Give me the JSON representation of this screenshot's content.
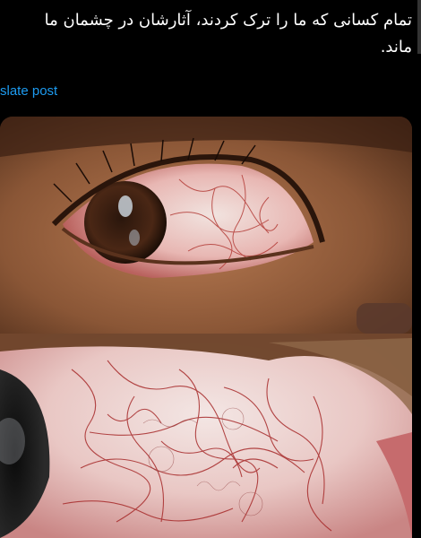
{
  "tweet": {
    "text_line1": "تمام کسانی که ما را ترک کردند، آثارشان در چشمان ما",
    "text_line2": "ماند.",
    "translate_label": "slate post"
  },
  "media": {
    "top_image": "closeup-eye-photo",
    "bottom_image": "macro-sclera-veins-faces-photo"
  },
  "colors": {
    "background": "#000000",
    "link": "#1d9bf0",
    "text": "#ffffff"
  }
}
